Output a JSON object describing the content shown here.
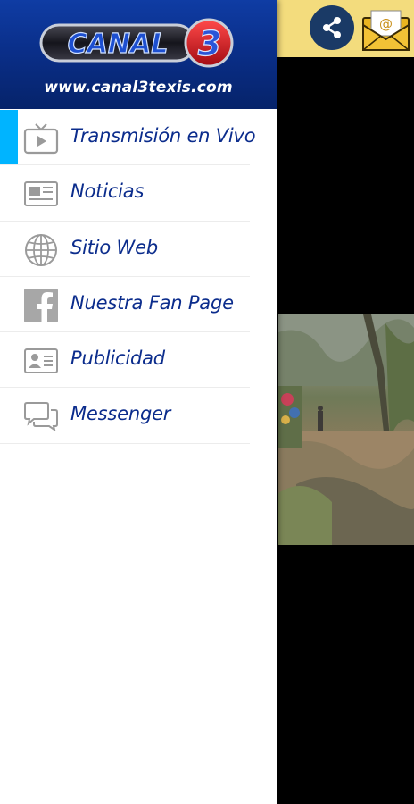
{
  "colors": {
    "header_blue": "#0a2f8a",
    "menu_text": "#0b2c8c",
    "active_accent": "#00b4ff",
    "app_bar": "#f3dc7d",
    "share_button": "#1a3a66"
  },
  "drawer": {
    "logo_text": "CANAL",
    "logo_number": "3",
    "site_url": "www.canal3texis.com",
    "items": [
      {
        "label": "Transmisión en Vivo",
        "icon": "tv-icon",
        "active": true
      },
      {
        "label": "Noticias",
        "icon": "newspaper-icon",
        "active": false
      },
      {
        "label": "Sitio Web",
        "icon": "globe-icon",
        "active": false
      },
      {
        "label": "Nuestra Fan Page",
        "icon": "facebook-icon",
        "active": false
      },
      {
        "label": "Publicidad",
        "icon": "contact-card-icon",
        "active": false
      },
      {
        "label": "Messenger",
        "icon": "chat-bubbles-icon",
        "active": false
      }
    ]
  },
  "app_bar": {
    "share_icon": "share-icon",
    "mail_icon": "email-envelope-icon",
    "mail_symbol": "@"
  }
}
